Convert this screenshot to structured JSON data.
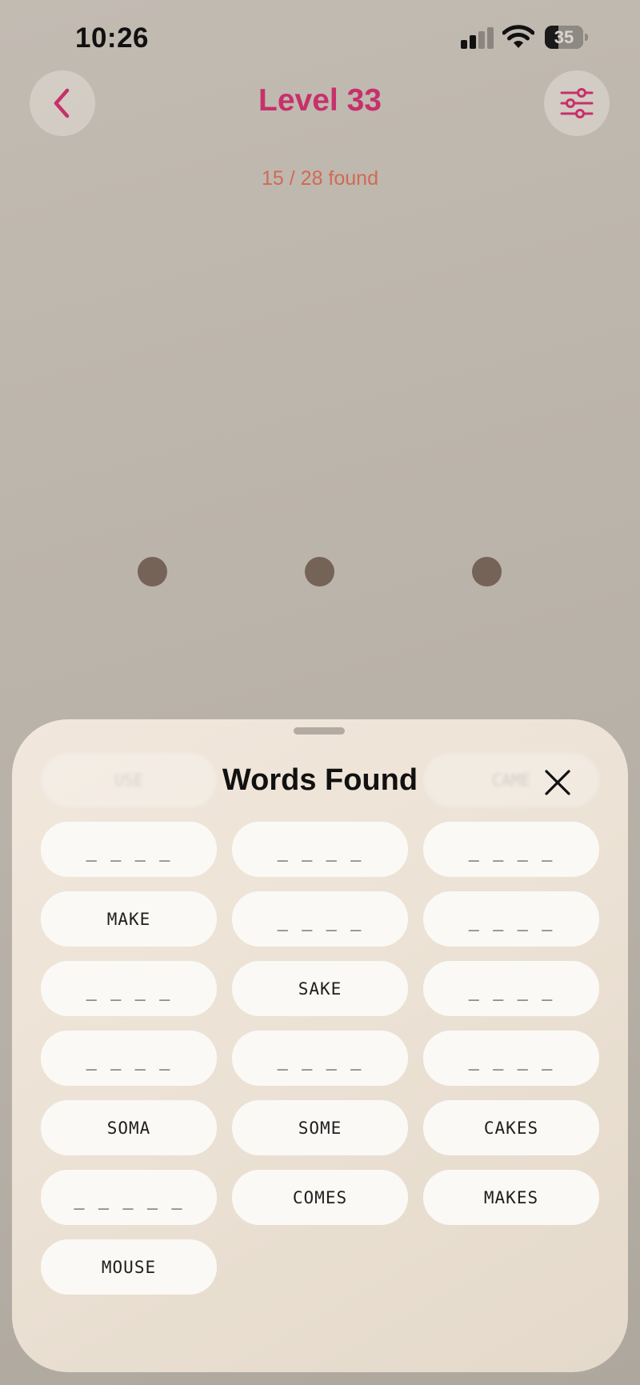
{
  "status_bar": {
    "time": "10:26",
    "battery_level": "35",
    "battery_fraction": 0.35
  },
  "header": {
    "title": "Level 33",
    "found_count": "15 / 28 found",
    "back_icon": "chevron-left-icon",
    "settings_icon": "sliders-icon"
  },
  "colors": {
    "accent": "#c7306a",
    "count": "#d06a55",
    "dot": "#756357"
  },
  "letter_wheel": {
    "dots": 3
  },
  "words_panel": {
    "title": "Words Found",
    "close_icon": "close-icon",
    "ghost_words": [
      "USE",
      "CAME"
    ],
    "words": [
      {
        "text": "_ _ _ _",
        "found": false
      },
      {
        "text": "_ _ _ _",
        "found": false
      },
      {
        "text": "_ _ _ _",
        "found": false
      },
      {
        "text": "MAKE",
        "found": true
      },
      {
        "text": "_ _ _ _",
        "found": false
      },
      {
        "text": "_ _ _ _",
        "found": false
      },
      {
        "text": "_ _ _ _",
        "found": false
      },
      {
        "text": "SAKE",
        "found": true
      },
      {
        "text": "_ _ _ _",
        "found": false
      },
      {
        "text": "_ _ _ _",
        "found": false
      },
      {
        "text": "_ _ _ _",
        "found": false
      },
      {
        "text": "_ _ _ _",
        "found": false
      },
      {
        "text": "SOMA",
        "found": true
      },
      {
        "text": "SOME",
        "found": true
      },
      {
        "text": "CAKES",
        "found": true
      },
      {
        "text": "_ _ _ _ _",
        "found": false
      },
      {
        "text": "COMES",
        "found": true
      },
      {
        "text": "MAKES",
        "found": true
      },
      {
        "text": "MOUSE",
        "found": true
      }
    ]
  }
}
